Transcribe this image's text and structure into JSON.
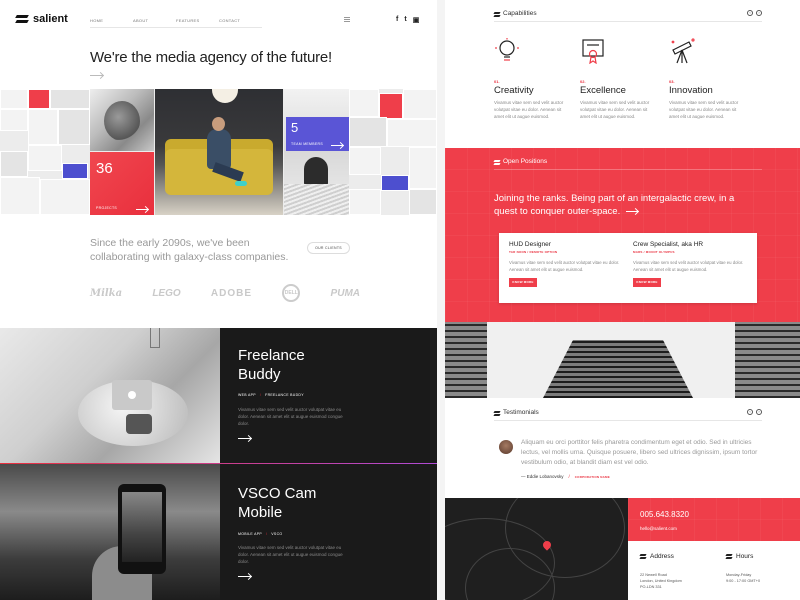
{
  "header": {
    "logo": "salient",
    "nav": [
      "HOME",
      "ABOUT",
      "FEATURES",
      "CONTACT"
    ],
    "socials": [
      "f",
      "t",
      "ig"
    ]
  },
  "hero": {
    "title": "We're the media agency of the future!"
  },
  "stats": {
    "projects": {
      "value": "36",
      "label": "PROJECTS"
    },
    "team": {
      "value": "5",
      "label": "TEAM MEMBERS"
    }
  },
  "clients": {
    "text": "Since the early 2090s, we've been collaborating with galaxy-class companies.",
    "button": "OUR CLIENTS",
    "brands": [
      "Milka",
      "LEGO",
      "ADOBE",
      "DELL",
      "PUMA"
    ]
  },
  "projects": [
    {
      "title_l1": "Freelance",
      "title_l2": "Buddy",
      "tag1": "WEB APP",
      "tag2": "FREELANCE BUDDY",
      "desc": "Vivamus vitae sem sed velit auctor volutpat vitae eu dolor. Aenean sit amet elit ut augue euismod congue dolor."
    },
    {
      "title_l1": "VSCO Cam",
      "title_l2": "Mobile",
      "tag1": "MOBILE APP",
      "tag2": "VSCO",
      "desc": "Vivamus vitae sem sed velit auctor volutpat vitae eu dolor. Aenean sit amet elit ut augue euismod congue dolor."
    }
  ],
  "capabilities": {
    "heading": "Capabilities",
    "items": [
      {
        "num": "01.",
        "title": "Creativity",
        "desc": "Vivamus vitae sem sed velit auctor volutpat vitae eu dolor. Aenean sit amet elit ut augue euismod."
      },
      {
        "num": "02.",
        "title": "Excellence",
        "desc": "Vivamus vitae sem sed velit auctor volutpat vitae eu dolor. Aenean sit amet elit ut augue euismod."
      },
      {
        "num": "03.",
        "title": "Innovation",
        "desc": "Vivamus vitae sem sed velit auctor volutpat vitae eu dolor. Aenean sit amet elit ut augue euismod."
      }
    ]
  },
  "positions": {
    "heading": "Open Positions",
    "text": "Joining the ranks. Being part of an intergalactic crew, in a quest to conquer outer-space.",
    "jobs": [
      {
        "title": "HUD Designer",
        "loc1": "TAR NOON",
        "loc2": "REMOTE OPTION",
        "desc": "Vivamus vitae sem sed velit auctor volutpat vitae eu dolor. Aenean sit amet elit ut augue euismod.",
        "button": "KNOW MORE"
      },
      {
        "title": "Crew Specialist, aka HR",
        "loc1": "MARS",
        "loc2": "MOUNT OLYMPUS",
        "desc": "Vivamus vitae sem sed velit auctor volutpat vitae eu dolor. Aenean sit amet elit ut augue euismod.",
        "button": "KNOW MORE"
      }
    ]
  },
  "testimonials": {
    "heading": "Testimonials",
    "quote": "Aliquam eu orci porttitor felis pharetra condimentum eget et odio. Sed in ultricies lectus, vel mollis urna. Quisque posuere, libero sed ultrices dignissim, ipsum tortor vestibulum odio, at blandit diam est vel odio.",
    "author": "— Eddie Lobanovsky",
    "role": "CORPORATION NAME"
  },
  "contact": {
    "phone": "005.643.8320",
    "email": "hello@salient.com",
    "address_heading": "Address",
    "address_lines": [
      "22 Newell Road",
      "London, United Kingdom",
      "PO-LDN 331"
    ],
    "hours_heading": "Hours",
    "hours_lines": [
      "Monday-Friday",
      "9:00 - 17:00 GMT+0"
    ]
  },
  "colors": {
    "accent": "#ef3e4a",
    "blue": "#5a55d6",
    "dark": "#1a1a1a"
  }
}
